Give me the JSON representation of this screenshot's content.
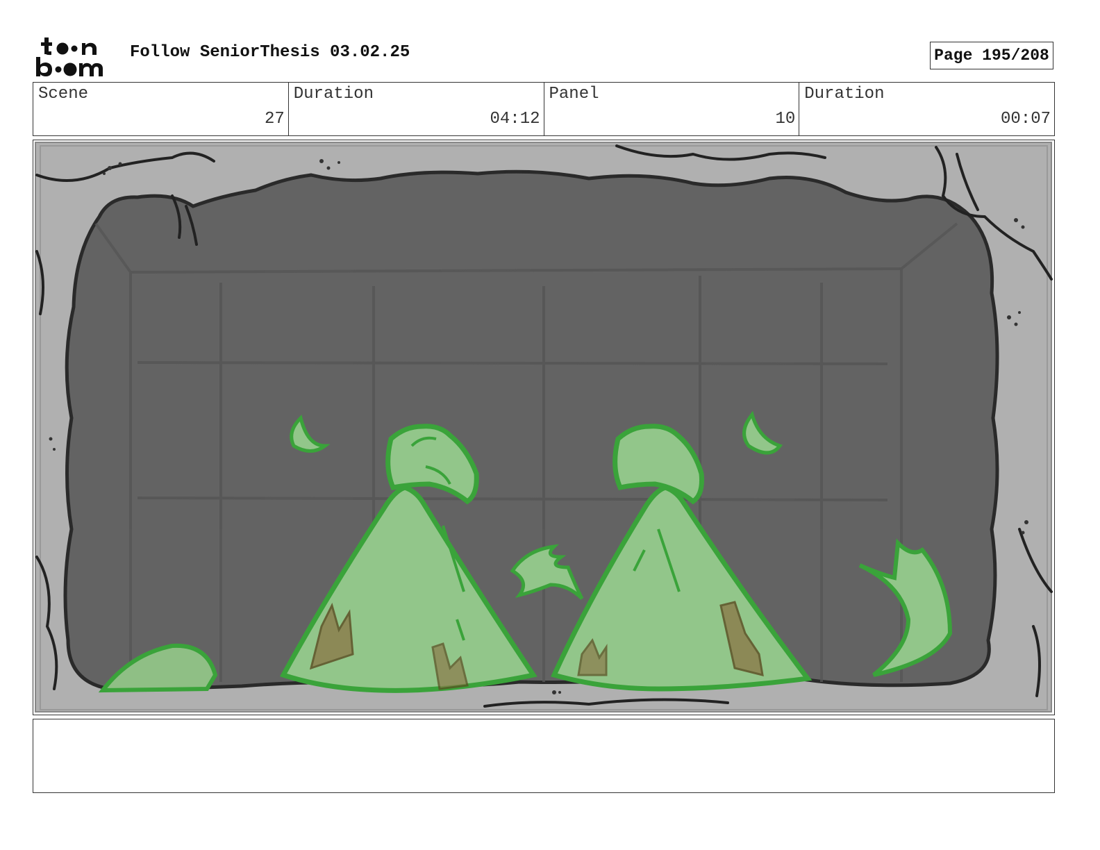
{
  "header": {
    "logo_text_top": "toon",
    "logo_text_bottom": "boom",
    "title": "Follow SeniorThesis 03.02.25",
    "page": "Page 195/208"
  },
  "info": {
    "scene_label": "Scene",
    "scene_value": "27",
    "scene_duration_label": "Duration",
    "scene_duration_value": "04:12",
    "panel_label": "Panel",
    "panel_value": "10",
    "panel_duration_label": "Duration",
    "panel_duration_value": "00:07"
  },
  "notes": {
    "text": ""
  }
}
